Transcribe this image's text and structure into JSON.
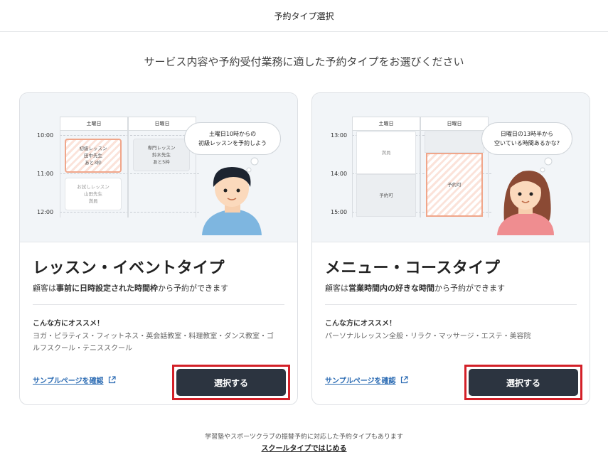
{
  "header": {
    "title": "予約タイプ選択"
  },
  "subtitle": "サービス内容や予約受付業務に適した予約タイプをお選びください",
  "cards": [
    {
      "illustration": {
        "days": [
          "土曜日",
          "日曜日"
        ],
        "times": [
          "10:00",
          "11:00",
          "12:00"
        ],
        "slots": [
          {
            "line1": "初級レッスン",
            "line2": "田中先生",
            "line3": "あと3枠"
          },
          {
            "line1": "専門レッスン",
            "line2": "鈴木先生",
            "line3": "あと5枠"
          },
          {
            "line1": "お試しレッスン",
            "line2": "山田先生",
            "line3": "満員"
          }
        ],
        "bubble_line1": "土曜日10時からの",
        "bubble_line2": "初級レッスンを予約しよう"
      },
      "title": "レッスン・イベントタイプ",
      "desc_pre": "顧客は",
      "desc_bold": "事前に日時設定された時間枠",
      "desc_post": "から予約ができます",
      "rec_title": "こんな方にオススメ！",
      "rec_text": "ヨガ・ピラティス・フィットネス・英会話教室・料理教室・ダンス教室・ゴルフスクール・テニススクール",
      "sample_link": "サンプルページを確認",
      "select_label": "選択する"
    },
    {
      "illustration": {
        "days": [
          "土曜日",
          "日曜日"
        ],
        "times": [
          "13:00",
          "14:00",
          "15:00"
        ],
        "slots": [
          {
            "line1": "満員"
          },
          {
            "line1": "予約可"
          },
          {
            "line1": "予約可"
          }
        ],
        "bubble_line1": "日曜日の13時半から",
        "bubble_line2": "空いている時間あるかな?"
      },
      "title": "メニュー・コースタイプ",
      "desc_pre": "顧客は",
      "desc_bold": "営業時間内の好きな時間",
      "desc_post": "から予約ができます",
      "rec_title": "こんな方にオススメ！",
      "rec_text": "パーソナルレッスン全般・リラク・マッサージ・エステ・美容院",
      "sample_link": "サンプルページを確認",
      "select_label": "選択する"
    }
  ],
  "footer": {
    "note": "学習塾やスポーツクラブの振替予約に対応した予約タイプもあります",
    "link": "スクールタイプではじめる"
  },
  "colors": {
    "select_bg": "#2c3440",
    "highlight_border": "#d32028",
    "link": "#2b6bb3",
    "hatch": "#f0a68a"
  }
}
